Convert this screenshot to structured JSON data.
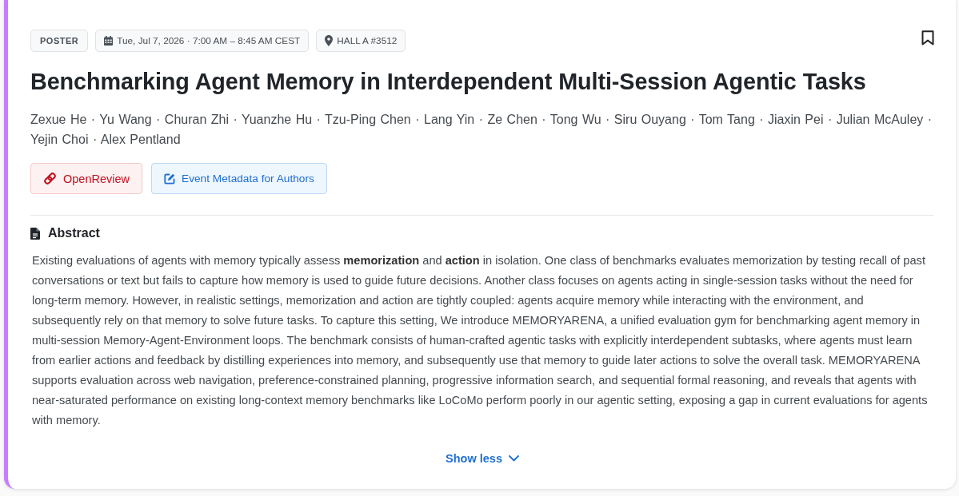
{
  "tags": [
    {
      "kind": "type",
      "label": "POSTER"
    },
    {
      "kind": "date",
      "label": "Tue, Jul 7, 2026 · 7:00 AM – 8:45 AM CEST"
    },
    {
      "kind": "location",
      "label": "HALL A #3512"
    }
  ],
  "bookmark": {
    "bookmarked": false
  },
  "title": "Benchmarking Agent Memory in Interdependent Multi-Session Agentic Tasks",
  "authors": "Zexue He · Yu Wang · Churan Zhi · Yuanzhe Hu · Tzu-Ping Chen · Lang Yin · Ze Chen · Tong Wu · Siru Ouyang · Tom Tang · Jiaxin Pei · Julian McAuley · Yejin Choi · Alex Pentland",
  "links": [
    {
      "kind": "openreview",
      "label": "OpenReview"
    },
    {
      "kind": "metadata",
      "label": "Event Metadata for Authors"
    }
  ],
  "abstract": {
    "heading": "Abstract",
    "text": "Existing evaluations of agents with memory typically assess **memorization** and **action** in isolation. One class of benchmarks evaluates memorization by testing recall of past conversations or text but fails to capture how memory is used to guide future decisions. Another class focuses on agents acting in single-session tasks without the need for long-term memory. However, in realistic settings, memorization and action are tightly coupled: agents acquire memory while interacting with the environment, and subsequently rely on that memory to solve future tasks. To capture this setting, We introduce MEMORYARENA, a unified evaluation gym for benchmarking agent memory in multi-session Memory-Agent-Environment loops. The benchmark consists of human-crafted agentic tasks with explicitly interdependent subtasks, where agents must learn from earlier actions and feedback by distilling experiences into memory, and subsequently use that memory to guide later actions to solve the overall task. MEMORYARENA supports evaluation across web navigation, preference-constrained planning, progressive information search, and sequential formal reasoning, and reveals that agents with near-saturated performance on existing long-context memory benchmarks like LoCoMo perform poorly in our agentic setting, exposing a gap in current evaluations for agents with memory."
  },
  "toggle": {
    "label": "Show less"
  }
}
